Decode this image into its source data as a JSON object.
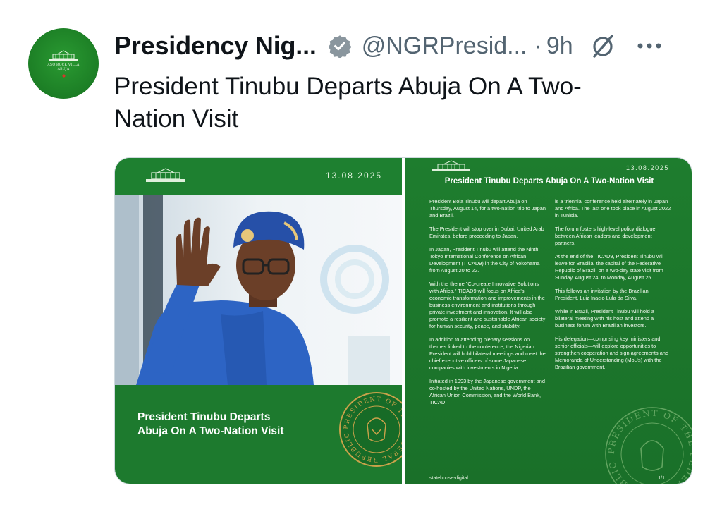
{
  "tweet": {
    "author_name": "Presidency Nig...",
    "handle": "@NGRPresid...",
    "separator": "·",
    "time": "9h",
    "text": "President Tinubu Departs Abuja On A Two-Nation Visit",
    "avatar_text": "ASO ROCK VILLA\nABUJA",
    "icons": {
      "verified": "verified-badge-icon",
      "grok": "grok-icon",
      "more": "more-options-icon"
    }
  },
  "media": {
    "left": {
      "date": "13.08.2025",
      "title": "President Tinubu Departs\nAbuja On A Two-Nation Visit",
      "seal_text": "PRESIDENT OF THE FEDERAL REPUBLIC · SEAL ·"
    },
    "right": {
      "date": "13.08.2025",
      "title": "President Tinubu Departs Abuja On A Two-Nation Visit",
      "col1": [
        "President Bola Tinubu will depart Abuja on Thursday, August 14, for a two-nation trip to Japan and Brazil.",
        "The President will stop over in Dubai, United Arab Emirates, before proceeding to Japan.",
        "In Japan, President Tinubu will attend the Ninth Tokyo International Conference on African Development (TICAD9) in the City of Yokohama from August 20 to 22.",
        "With the theme \"Co-create Innovative Solutions with Africa,\" TICAD9 will focus on Africa's economic transformation and improvements in the business environment and institutions through private investment and innovation. It will also promote a resilient and sustainable African society for human security, peace, and stability.",
        "In addition to attending plenary sessions on themes linked to the conference, the Nigerian President will hold bilateral meetings and meet the chief executive officers of some Japanese companies with investments in Nigeria.",
        "Initiated in 1993 by the Japanese government and co-hosted by the United Nations, UNDP, the African Union Commission, and the World Bank, TICAD"
      ],
      "col2": [
        "is a triennial conference held alternately in Japan and Africa. The last one took place in August 2022 in Tunisia.",
        "The forum fosters high-level policy dialogue between African leaders and development partners.",
        "At the end of the TICAD9, President Tinubu will leave for Brasilia, the capital of the Federative Republic of Brazil, on a two-day state visit from Sunday, August 24, to Monday, August 25.",
        "This follows an invitation by the Brazilian President, Luiz Inacio Lula da Silva.",
        "While in Brazil, President Tinubu will hold a bilateral meeting with his host and attend a business forum with Brazilian investors.",
        "His delegation—comprising key ministers and senior officials—will explore opportunities to strengthen cooperation and sign agreements and Memoranda of Understanding (MoUs) with the Brazilian government."
      ],
      "seal_text": "PRESIDENT OF THE FEDERAL REPUBLIC ·",
      "footer_left": "statehouse-digital",
      "footer_right": "1/1"
    }
  },
  "colors": {
    "brand_green": "#1d7a2e",
    "verified_blue": "#1d9bf0",
    "secondary_text": "#536471",
    "seal_gold": "#c9a24a"
  }
}
